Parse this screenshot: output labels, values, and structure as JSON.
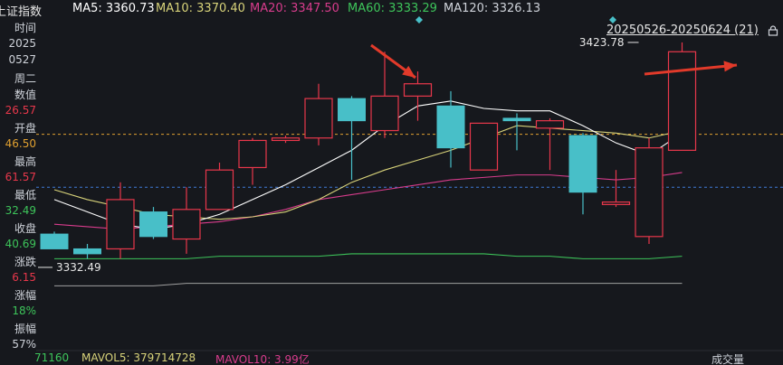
{
  "header": {
    "title": "上证指数",
    "ma5": "MA5: 3360.73",
    "ma10": "MA10: 3370.40",
    "ma20": "MA20: 3347.50",
    "ma60": "MA60: 3333.29",
    "ma120": "MA120: 3326.13"
  },
  "range_label": "20250526-20250624 (21)",
  "sidebar": {
    "rows": [
      "时间",
      "2025",
      "0527",
      "周二",
      "数值",
      "26.57",
      "开盘",
      "46.50",
      "最高",
      "61.57",
      "最低",
      "32.49",
      "收盘",
      "40.69",
      "涨跌",
      "6.15",
      "涨幅",
      "18%",
      "振幅",
      "57%"
    ]
  },
  "annotations": {
    "high_label": "3423.78",
    "low_label": "3332.49"
  },
  "footer": {
    "vol": "71160",
    "mavol5": "MAVOL5: 379714728",
    "mavol10": "MAVOL10: 3.99亿",
    "volume_tag": "成交量"
  },
  "colors": {
    "up": "#e8374b",
    "down": "#48bfc8",
    "ma5": "#ffffff",
    "ma10": "#d8d37a",
    "ma20": "#d83c8c",
    "ma60": "#3dc45a",
    "ma120": "#a0a0a0",
    "dashed_orange": "#e0a030",
    "dashed_blue": "#3f7bd8"
  },
  "chart_data": {
    "type": "candlestick",
    "candles": [
      {
        "o": 3346,
        "h": 3347,
        "l": 3340,
        "c": 3340,
        "dir": "down"
      },
      {
        "o": 3340,
        "h": 3342,
        "l": 3336,
        "c": 3338,
        "dir": "down"
      },
      {
        "o": 3340,
        "h": 3367,
        "l": 3336,
        "c": 3360,
        "dir": "up"
      },
      {
        "o": 3355,
        "h": 3357,
        "l": 3344,
        "c": 3345,
        "dir": "down"
      },
      {
        "o": 3344,
        "h": 3365,
        "l": 3338,
        "c": 3356,
        "dir": "up"
      },
      {
        "o": 3356,
        "h": 3375,
        "l": 3356,
        "c": 3372,
        "dir": "up"
      },
      {
        "o": 3373,
        "h": 3385,
        "l": 3366,
        "c": 3384,
        "dir": "up"
      },
      {
        "o": 3384,
        "h": 3386,
        "l": 3383,
        "c": 3385,
        "dir": "up"
      },
      {
        "o": 3385,
        "h": 3407,
        "l": 3382,
        "c": 3401,
        "dir": "up"
      },
      {
        "o": 3401,
        "h": 3402,
        "l": 3368,
        "c": 3392,
        "dir": "down"
      },
      {
        "o": 3388,
        "h": 3420,
        "l": 3385,
        "c": 3402,
        "dir": "up"
      },
      {
        "o": 3402,
        "h": 3412,
        "l": 3392,
        "c": 3407,
        "dir": "up"
      },
      {
        "o": 3398,
        "h": 3404,
        "l": 3373,
        "c": 3381,
        "dir": "down"
      },
      {
        "o": 3372,
        "h": 3391,
        "l": 3372,
        "c": 3391,
        "dir": "up"
      },
      {
        "o": 3393,
        "h": 3395,
        "l": 3380,
        "c": 3392,
        "dir": "down"
      },
      {
        "o": 3389,
        "h": 3393,
        "l": 3372,
        "c": 3392,
        "dir": "up"
      },
      {
        "o": 3386,
        "h": 3387,
        "l": 3354,
        "c": 3363,
        "dir": "down"
      },
      {
        "o": 3359,
        "h": 3372,
        "l": 3357,
        "c": 3358,
        "dir": "up"
      },
      {
        "o": 3345,
        "h": 3385,
        "l": 3342,
        "c": 3381,
        "dir": "up"
      },
      {
        "o": 3380,
        "h": 3423.78,
        "l": 3380,
        "c": 3420,
        "dir": "up"
      }
    ],
    "ma5": [
      3360,
      3355,
      3350,
      3348,
      3350,
      3354,
      3360,
      3366,
      3373,
      3380,
      3390,
      3398,
      3400,
      3397,
      3396,
      3396,
      3390,
      3383,
      3378,
      3387
    ],
    "ma10": [
      3364,
      3360,
      3357,
      3354,
      3353,
      3352,
      3353,
      3355,
      3360,
      3367,
      3372,
      3376,
      3380,
      3385,
      3390,
      3389,
      3388,
      3387,
      3385,
      3388
    ],
    "ma20": [
      3350,
      3349,
      3348,
      3349,
      3350,
      3351,
      3353,
      3356,
      3360,
      3362,
      3364,
      3366,
      3368,
      3369,
      3370,
      3370,
      3369,
      3368,
      3369,
      3371
    ],
    "ma60": [
      3336,
      3336,
      3336,
      3336,
      3336,
      3337,
      3337,
      3337,
      3337,
      3338,
      3338,
      3338,
      3338,
      3338,
      3337,
      3337,
      3336,
      3336,
      3336,
      3337
    ],
    "ma120": [
      3325,
      3325,
      3325,
      3325,
      3326,
      3326,
      3326,
      3326,
      3326,
      3326,
      3326,
      3326,
      3326,
      3326,
      3326,
      3326,
      3326,
      3326,
      3326,
      3326
    ],
    "ylim": [
      3320,
      3430
    ],
    "dashed_levels": [
      3386.5,
      3365
    ]
  }
}
